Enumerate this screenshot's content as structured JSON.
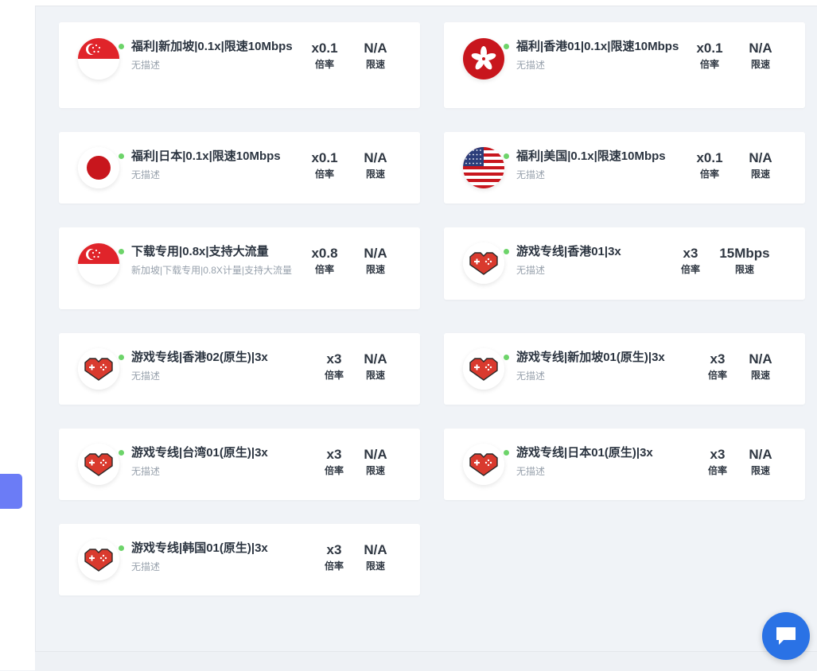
{
  "colors": {
    "accent": "#6b7cf6",
    "online_dot": "#6dd46a",
    "chat": "#2a72e5"
  },
  "cards": [
    {
      "flag": "singapore-flag-icon",
      "title": "福利|新加坡|0.1x|限速10Mbps",
      "desc": "无描述",
      "rate": "x0.1",
      "rate_label": "倍率",
      "speed": "N/A",
      "speed_label": "限速"
    },
    {
      "flag": "hongkong-flag-icon",
      "title": "福利|香港01|0.1x|限速10Mbps",
      "desc": "无描述",
      "rate": "x0.1",
      "rate_label": "倍率",
      "speed": "N/A",
      "speed_label": "限速"
    },
    {
      "flag": "japan-flag-icon",
      "title": "福利|日本|0.1x|限速10Mbps",
      "desc": "无描述",
      "rate": "x0.1",
      "rate_label": "倍率",
      "speed": "N/A",
      "speed_label": "限速"
    },
    {
      "flag": "usa-flag-icon",
      "title": "福利|美国|0.1x|限速10Mbps",
      "desc": "无描述",
      "rate": "x0.1",
      "rate_label": "倍率",
      "speed": "N/A",
      "speed_label": "限速"
    },
    {
      "flag": "singapore-flag-icon",
      "title": "下载专用|0.8x|支持大流量",
      "desc": "新加坡|下载专用|0.8X计量|支持大流量",
      "rate": "x0.8",
      "rate_label": "倍率",
      "speed": "N/A",
      "speed_label": "限速"
    },
    {
      "flag": "gamepad-heart-icon",
      "title": "游戏专线|香港01|3x",
      "desc": "无描述",
      "rate": "x3",
      "rate_label": "倍率",
      "speed": "15Mbps",
      "speed_label": "限速"
    },
    {
      "flag": "gamepad-heart-icon",
      "title": "游戏专线|香港02(原生)|3x",
      "desc": "无描述",
      "rate": "x3",
      "rate_label": "倍率",
      "speed": "N/A",
      "speed_label": "限速"
    },
    {
      "flag": "gamepad-heart-icon",
      "title": "游戏专线|新加坡01(原生)|3x",
      "desc": "无描述",
      "rate": "x3",
      "rate_label": "倍率",
      "speed": "N/A",
      "speed_label": "限速"
    },
    {
      "flag": "gamepad-heart-icon",
      "title": "游戏专线|台湾01(原生)|3x",
      "desc": "无描述",
      "rate": "x3",
      "rate_label": "倍率",
      "speed": "N/A",
      "speed_label": "限速"
    },
    {
      "flag": "gamepad-heart-icon",
      "title": "游戏专线|日本01(原生)|3x",
      "desc": "无描述",
      "rate": "x3",
      "rate_label": "倍率",
      "speed": "N/A",
      "speed_label": "限速"
    },
    {
      "flag": "gamepad-heart-icon",
      "title": "游戏专线|韩国01(原生)|3x",
      "desc": "无描述",
      "rate": "x3",
      "rate_label": "倍率",
      "speed": "N/A",
      "speed_label": "限速"
    }
  ]
}
